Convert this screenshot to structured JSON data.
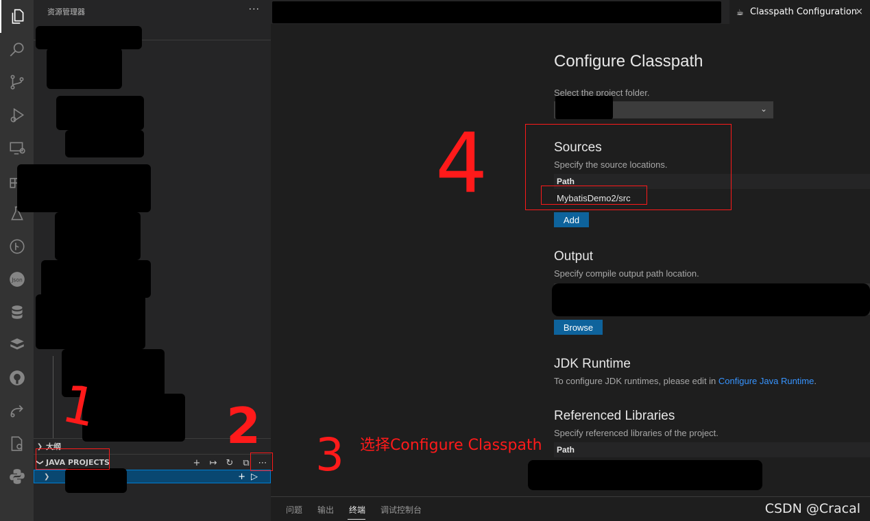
{
  "sidebar": {
    "title": "资源管理器",
    "more": "···",
    "outline_label": "大纲",
    "java_projects_label": "JAVA PROJECTS"
  },
  "tab": {
    "title": "Classpath Configuration",
    "close": "×"
  },
  "config": {
    "title": "Configure Classpath",
    "select_project_label": "Select the project folder.",
    "sources": {
      "heading": "Sources",
      "description": "Specify the source locations.",
      "column_header": "Path",
      "paths": [
        "MybatisDemo2/src"
      ],
      "add_button": "Add"
    },
    "output": {
      "heading": "Output",
      "description": "Specify compile output path location.",
      "browse_button": "Browse"
    },
    "jdk": {
      "heading": "JDK Runtime",
      "description_prefix": "To configure JDK runtimes, please edit in ",
      "link_text": "Configure Java Runtime",
      "description_suffix": "."
    },
    "libraries": {
      "heading": "Referenced Libraries",
      "description": "Specify referenced libraries of the project.",
      "column_header": "Path"
    }
  },
  "panel": {
    "tabs": [
      "问题",
      "输出",
      "终端",
      "调试控制台"
    ],
    "active_tab": "终端"
  },
  "annotations": {
    "step1": "1",
    "step2": "2",
    "step3": "3",
    "step3_text": "选择Configure Classpath",
    "step4": "4"
  },
  "watermark": "CSDN @Cracal",
  "colors": {
    "activity_bar": "#333333",
    "sidebar": "#252526",
    "editor": "#1e1e1e",
    "button": "#0e639c",
    "link": "#3794ff",
    "selection": "#094771",
    "annotation_red": "#ff1a1a"
  }
}
